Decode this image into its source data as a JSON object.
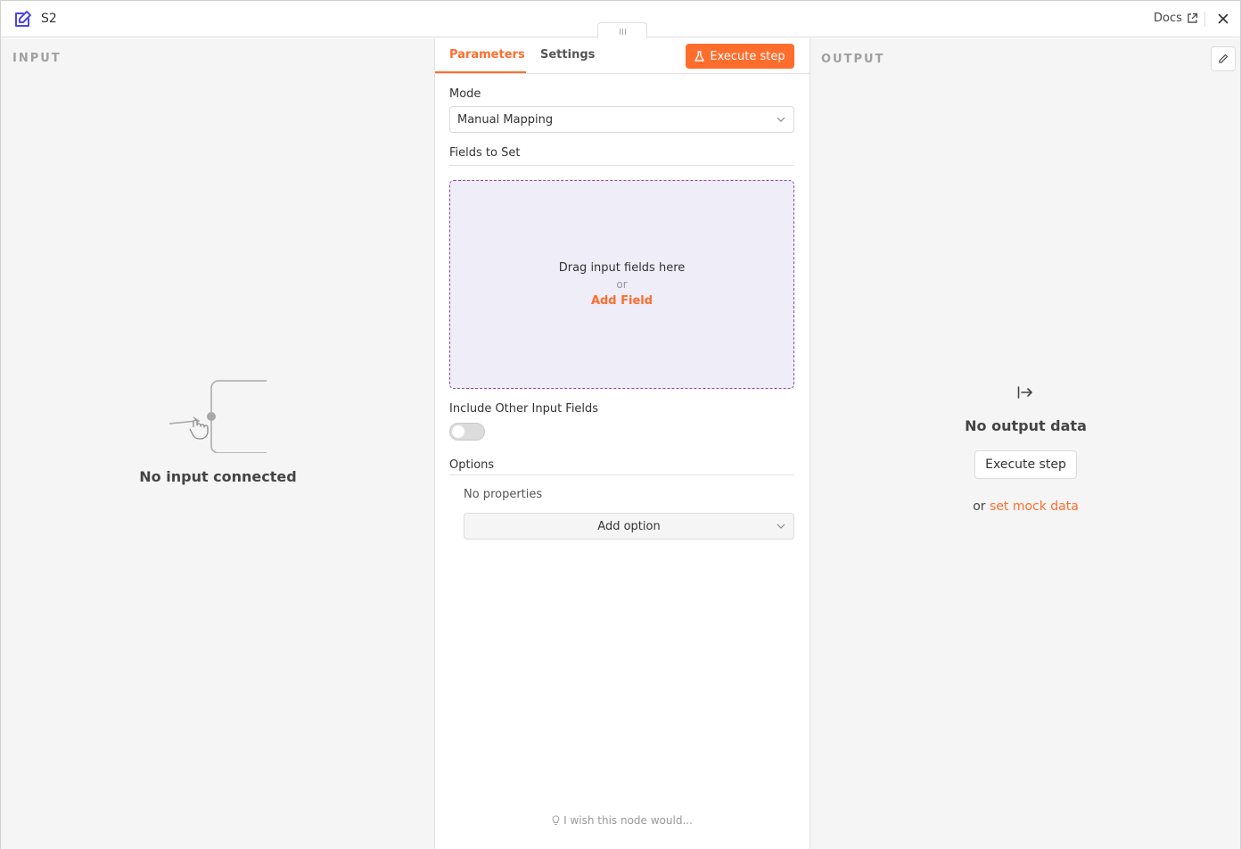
{
  "header": {
    "title": "S2",
    "docs_label": "Docs"
  },
  "input_panel": {
    "label": "INPUT",
    "empty_text": "No input connected"
  },
  "center": {
    "tabs": [
      {
        "label": "Parameters",
        "active": true
      },
      {
        "label": "Settings",
        "active": false
      }
    ],
    "execute_label": "Execute step",
    "mode": {
      "label": "Mode",
      "value": "Manual Mapping"
    },
    "fields_to_set": {
      "label": "Fields to Set",
      "drag_text": "Drag input fields here",
      "or_text": "or",
      "add_field_label": "Add Field"
    },
    "include_other": {
      "label": "Include Other Input Fields",
      "enabled": false
    },
    "options": {
      "label": "Options",
      "empty_text": "No properties",
      "add_option_label": "Add option"
    },
    "feedback_text": "I wish this node would..."
  },
  "output_panel": {
    "label": "OUTPUT",
    "empty_title": "No output data",
    "execute_label": "Execute step",
    "or_text": "or",
    "mock_link": "set mock data"
  },
  "colors": {
    "accent": "#ff6d2d",
    "node_icon": "#4f46e5",
    "drop_border": "#8b4ba0",
    "drop_bg": "#eeedf8"
  },
  "icons": [
    "edit-node-icon",
    "external-link-icon",
    "close-icon",
    "flask-icon",
    "chevron-down-icon",
    "lightbulb-icon",
    "sign-in-icon",
    "pencil-icon"
  ]
}
